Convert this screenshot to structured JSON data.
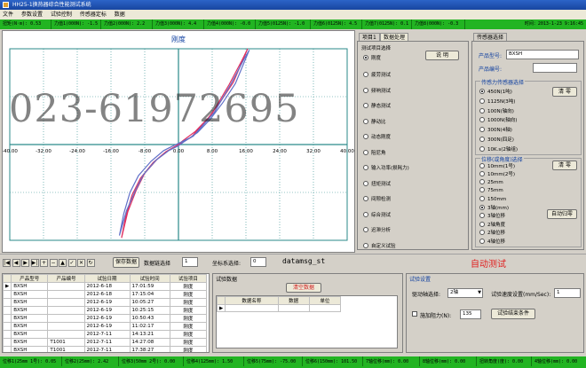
{
  "window": {
    "title": "HH25-1换热器综合性能测试系统"
  },
  "menu": [
    "文件",
    "参数设置",
    "试验控制",
    "传感器定标",
    "数据"
  ],
  "top_status": [
    "扭矩(N·m): 0.53",
    "力值1(000N): -1.5",
    "力值2(000N): 2.2",
    "力值3(000N): 4.4",
    "力值4(000N): -0.0",
    "力值5(0125N): -1.0",
    "力值6(0125N): 4.5",
    "力值7(0125N): 0.1",
    "力值8(000N): -0.3",
    "时间：2013-1-23 9:16:45"
  ],
  "chart": {
    "title": "刚度",
    "x_ticks": [
      "-40.00",
      "-32.00",
      "-24.00",
      "-16.00",
      "-8.00",
      "0.00",
      "8.00",
      "16.00",
      "24.00",
      "32.00",
      "40.00"
    ],
    "y_ticks": [
      "-8.00",
      "-4.00",
      "0.00",
      "4.00",
      "8.00"
    ],
    "watermark": "023-61972695"
  },
  "chart_data": {
    "type": "line",
    "title": "刚度",
    "xlabel": "",
    "ylabel": "",
    "xlim": [
      -40,
      40
    ],
    "ylim": [
      -8,
      8
    ],
    "series": [
      {
        "color": "#e03060",
        "x": [
          -13.5,
          -12.5,
          -11,
          -9,
          -6,
          -3,
          -1,
          0,
          1,
          3,
          5,
          8,
          10,
          12,
          13.5,
          15,
          16.4,
          13,
          10,
          7,
          4,
          1,
          0,
          -2,
          -5,
          -8,
          -10,
          -12,
          -13.5
        ],
        "y": [
          -7.8,
          -6,
          -4.2,
          -2.8,
          -1.5,
          -0.6,
          -0.2,
          0,
          0.2,
          0.6,
          1.4,
          2.6,
          3.8,
          5,
          6,
          7,
          8,
          5.2,
          3.6,
          2.2,
          1.1,
          0.3,
          0,
          -0.4,
          -1.2,
          -2.4,
          -3.8,
          -5.6,
          -7.8
        ]
      },
      {
        "color": "#6070c8",
        "x": [
          -14,
          -13,
          -11.5,
          -9.5,
          -6.5,
          -3.5,
          -1.2,
          0,
          1.2,
          3.5,
          5.5,
          8.5,
          10.5,
          12.5,
          14,
          15.5,
          16.8,
          13.5,
          10.5,
          7.5,
          4.5,
          1.2,
          0,
          -2.3,
          -5.3,
          -8.3,
          -10.3,
          -12.3,
          -14
        ],
        "y": [
          -7.6,
          -5.8,
          -4,
          -2.6,
          -1.4,
          -0.5,
          -0.1,
          0.1,
          0.3,
          0.7,
          1.5,
          2.7,
          3.9,
          5.1,
          6.1,
          7.1,
          7.9,
          5.1,
          3.5,
          2.1,
          1,
          0.2,
          -0.1,
          -0.5,
          -1.3,
          -2.5,
          -3.9,
          -5.5,
          -7.6
        ]
      }
    ]
  },
  "tabs": {
    "project": "项目1",
    "data_processing": "数据处理",
    "sensor": "传感器选择"
  },
  "test_items": {
    "title": "测试项目选择",
    "selected_label": "刚度",
    "explain_btn": "说 明",
    "items": [
      "疲劳测试",
      "频响测试",
      "静态测试",
      "静动比",
      "动态刚度",
      "阻尼角",
      "输入功率(损耗力)",
      "扭矩测试",
      "间隙检测",
      "综合测试",
      "迟滞分析",
      "自定义试验"
    ]
  },
  "sensor": {
    "model_label": "产品型号:",
    "model_value": "BXSH",
    "serial_label": "产品编号:",
    "serial_value": "",
    "force_group": "传感力传感器选择",
    "force_opts": [
      "450N(1吨)",
      "1125N(3吨)",
      "100N(轴向)",
      "1000N(轴向)",
      "300N(4轴)",
      "300N(四足)",
      "10K.s(2轴组)"
    ],
    "force_zero": "清 零",
    "disp_group": "位移(或角度)选择",
    "disp_opts": [
      "10mm(1号)",
      "10mm(2号)",
      "25mm",
      "75mm",
      "150mm",
      "3轴(mm)",
      "3轴位移",
      "2轴角度",
      "2轴位移",
      "4轴位移"
    ],
    "disp_zero": "清 零",
    "auto_zero": "自动归零"
  },
  "toolbar": {
    "nav": [
      "|◀",
      "◀",
      "▶",
      "▶|",
      "+",
      "−",
      "▲",
      "✓",
      "✕",
      "↻"
    ],
    "save_btn": "保存数据",
    "data_select_label": "数据链选择",
    "data_select_value": "1",
    "coord_label": "坐标系选择:",
    "coord_value": "0",
    "file_name": "datamsg_st",
    "auto_test": "自动测试"
  },
  "records": {
    "headers": [
      "产品型号",
      "产品编号",
      "试验日期",
      "试验时间",
      "试验项目"
    ],
    "rows": [
      [
        "BXSH",
        "",
        "2012-6-18",
        "17:01:59",
        "刚度"
      ],
      [
        "BXSH",
        "",
        "2012-6-18",
        "17:15:04",
        "刚度"
      ],
      [
        "BXSH",
        "",
        "2012-6-19",
        "10:05:27",
        "刚度"
      ],
      [
        "BXSH",
        "",
        "2012-6-19",
        "10:25:15",
        "刚度"
      ],
      [
        "BXSH",
        "",
        "2012-6-19",
        "10:50:43",
        "刚度"
      ],
      [
        "BXSH",
        "",
        "2012-6-19",
        "11:02:17",
        "刚度"
      ],
      [
        "BXSH",
        "",
        "2012-7-11",
        "14:13:21",
        "刚度"
      ],
      [
        "BXSH",
        "T1001",
        "2012-7-11",
        "14:27:08",
        "刚度"
      ],
      [
        "BXSH",
        "T1001",
        "2012-7-11",
        "17:38:27",
        "刚度"
      ],
      [
        "BXSH",
        "",
        "2012-7-11",
        "9:44:51",
        "刚度"
      ]
    ]
  },
  "test_data": {
    "title": "试验数据",
    "clear_btn": "清空数据",
    "headers": [
      "数据名称",
      "数据",
      "单位"
    ]
  },
  "settings": {
    "title": "试验设置",
    "axis_label": "驱动轴选择:",
    "axis_value": "2轴",
    "speed_label": "试验速度设置(mm/Sec):",
    "speed_value": "1",
    "preload_label": "施加阻力(N):",
    "preload_value": "135",
    "end_btn": "试验结束条件"
  },
  "bottom_status": [
    "位移1(25mm 1号): 0.05",
    "位移2(25mm): 2.42",
    "位移3(50mm 2号): 0.00",
    "位移4(125mm): 1.50",
    "位移5(75mm): -75.00",
    "位移6(150mm): 101.50",
    "7轴位移(mm): 0.00",
    "8轴位移(mm): 0.00",
    "扭转角度(度): 0.00",
    "4轴位移(mm): 0.00"
  ]
}
